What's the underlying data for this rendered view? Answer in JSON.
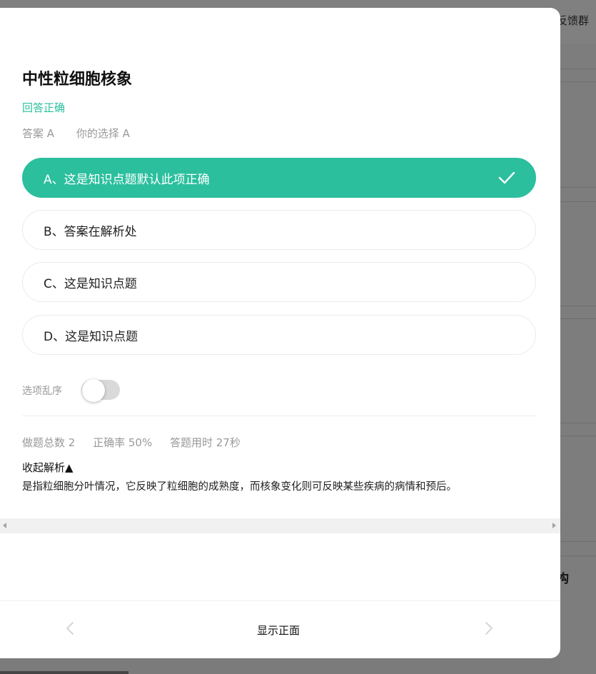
{
  "background": {
    "topbar_text": "反馈群",
    "side_text": "构"
  },
  "card": {
    "title": "中性粒细胞核象",
    "result": "回答正确",
    "answer": "答案 A",
    "your_choice": "你的选择 A",
    "options": [
      {
        "label": "A、这是知识点题默认此项正确",
        "selected": true
      },
      {
        "label": "B、答案在解析处",
        "selected": false
      },
      {
        "label": "C、这是知识点题",
        "selected": false
      },
      {
        "label": "D、这是知识点题",
        "selected": false
      }
    ],
    "shuffle_label": "选项乱序",
    "shuffle_on": false,
    "stats": {
      "total": "做题总数 2",
      "accuracy": "正确率 50%",
      "time": "答题用时 27秒"
    },
    "analysis_toggle": "收起解析▲",
    "analysis_text": "是指粒细胞分叶情况，它反映了粒细胞的成熟度，而核象变化则可反映某些疾病的病情和预后。"
  },
  "footer": {
    "show_front": "显示正面"
  },
  "colors": {
    "accent": "#2bbf9e",
    "overlay": "#7b7b7b"
  },
  "icons": {
    "check": "check-icon",
    "prev": "chevron-left-icon",
    "next": "chevron-right-icon"
  }
}
